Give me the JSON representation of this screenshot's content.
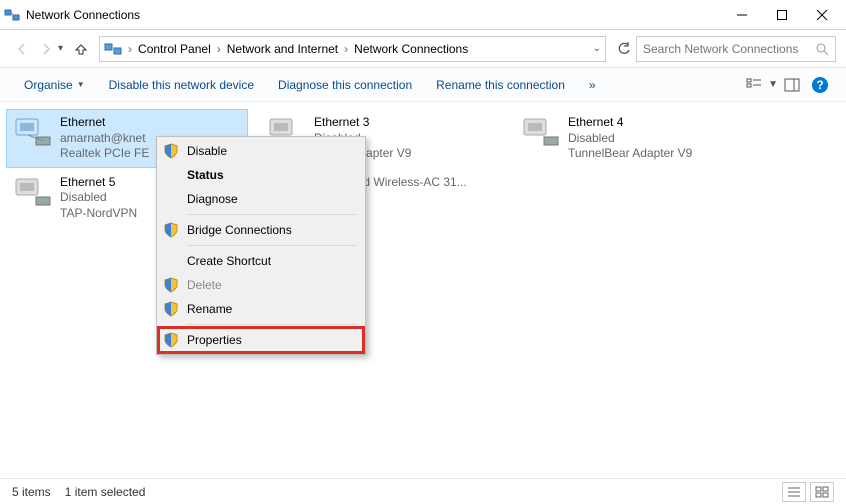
{
  "window": {
    "title": "Network Connections"
  },
  "breadcrumb": {
    "items": [
      "Control Panel",
      "Network and Internet",
      "Network Connections"
    ]
  },
  "search": {
    "placeholder": "Search Network Connections"
  },
  "toolbar": {
    "organise": "Organise",
    "disable": "Disable this network device",
    "diagnose": "Diagnose this connection",
    "rename": "Rename this connection",
    "more": "»"
  },
  "adapters": [
    {
      "name": "Ethernet",
      "line2": "amarnath@knet",
      "line3": "Realtek PCIe FE",
      "selected": true
    },
    {
      "name": "Ethernet 3",
      "line2": "Disabled",
      "line3": "ndows Adapter V9"
    },
    {
      "name": "Ethernet 4",
      "line2": "Disabled",
      "line3": "TunnelBear Adapter V9"
    },
    {
      "name": "Ethernet 5",
      "line2": "Disabled",
      "line3": "TAP-NordVPN"
    },
    {
      "name": "",
      "line2": "",
      "line3": "Dual Band Wireless-AC 31..."
    }
  ],
  "context_menu": {
    "disable": "Disable",
    "status": "Status",
    "diagnose": "Diagnose",
    "bridge": "Bridge Connections",
    "shortcut": "Create Shortcut",
    "delete": "Delete",
    "rename": "Rename",
    "properties": "Properties"
  },
  "status": {
    "count": "5 items",
    "selected": "1 item selected"
  }
}
